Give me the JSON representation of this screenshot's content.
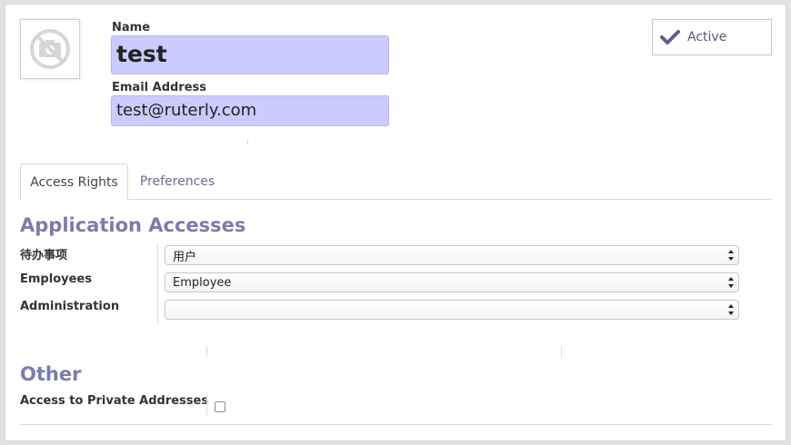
{
  "header": {
    "avatar_icon": "camera-off-icon",
    "name_label": "Name",
    "name_value": "test",
    "email_label": "Email Address",
    "email_value": "test@ruterly.com",
    "active_label": "Active",
    "active_icon": "checkmark-icon"
  },
  "tabs": [
    {
      "label": "Access Rights",
      "active": true
    },
    {
      "label": "Preferences",
      "active": false
    }
  ],
  "app_accesses": {
    "title": "Application Accesses",
    "rows": [
      {
        "label": "待办事项",
        "value": "用户"
      },
      {
        "label": "Employees",
        "value": "Employee"
      },
      {
        "label": "Administration",
        "value": ""
      }
    ]
  },
  "other": {
    "title": "Other",
    "rows": [
      {
        "label": "Access to Private Addresses",
        "checked": false
      }
    ]
  },
  "colors": {
    "accent": "#7c7bad",
    "input_highlight": "#cccbff",
    "check": "#5f5e8a"
  }
}
